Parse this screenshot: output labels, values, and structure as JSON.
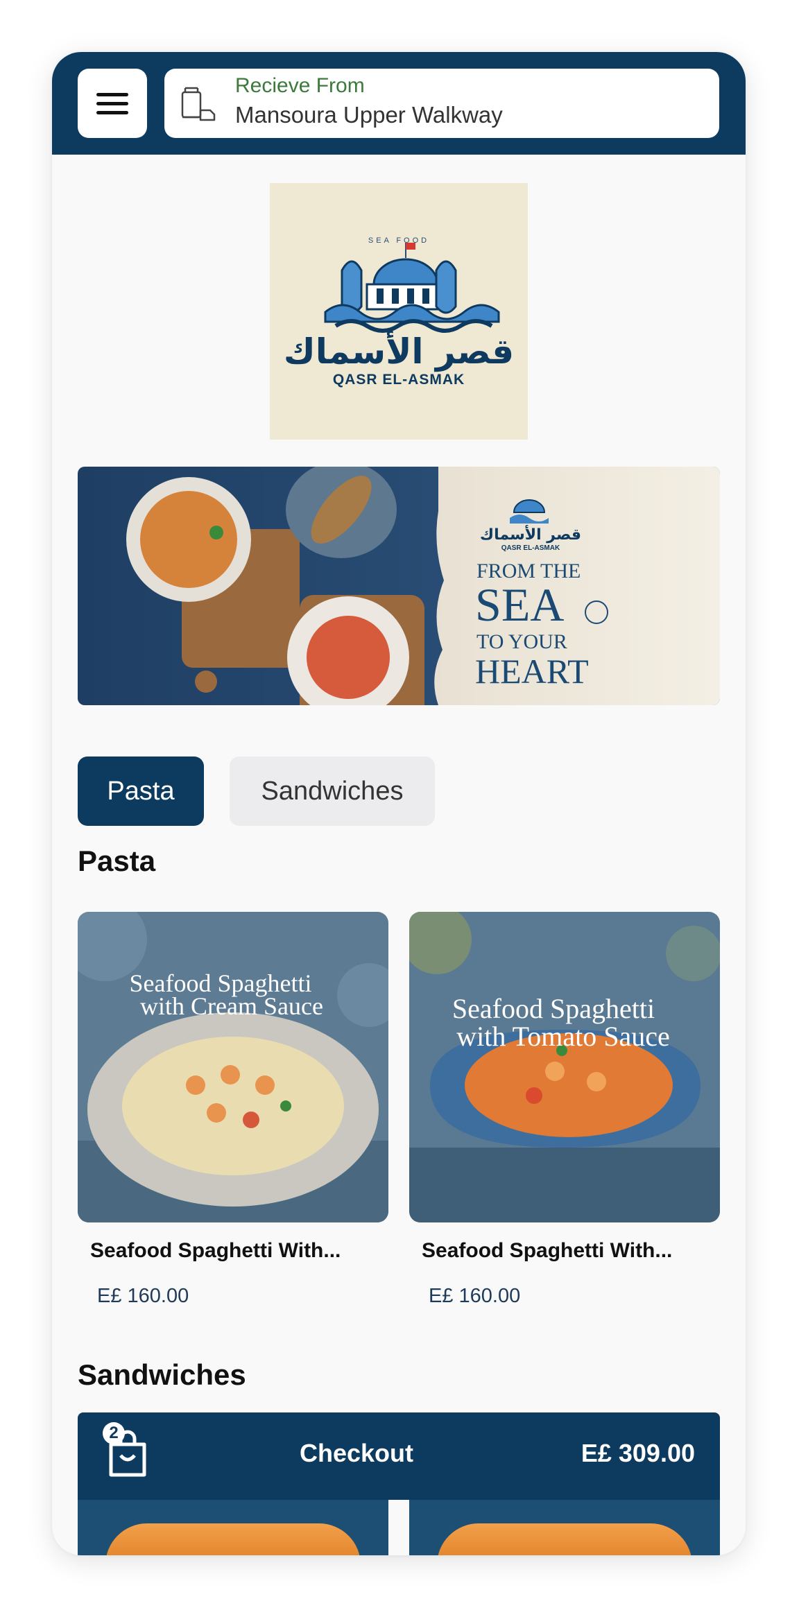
{
  "header": {
    "pickup_label": "Recieve From",
    "pickup_value": "Mansoura Upper Walkway"
  },
  "logo": {
    "arabic_name": "قصر الأسماك",
    "latin_name": "QASR EL-ASMAK",
    "tagline": "SEA FOOD"
  },
  "banner": {
    "logo_arabic": "قصر الأسماك",
    "logo_latin": "QASR EL-ASMAK",
    "line1": "FROM THE",
    "line2": "SEA",
    "line3": "TO YOUR",
    "line4": "HEART"
  },
  "tabs": [
    {
      "label": "Pasta",
      "active": true
    },
    {
      "label": "Sandwiches",
      "active": false
    }
  ],
  "sections": {
    "pasta_title": "Pasta",
    "sandwiches_title": "Sandwiches"
  },
  "products": [
    {
      "name": "Seafood Spaghetti With...",
      "price": "E£ 160.00",
      "image_line1": "Seafood Spaghetti",
      "image_line2": "with Cream Sauce",
      "plate_color": "#c9c7c0"
    },
    {
      "name": "Seafood Spaghetti With...",
      "price": "E£ 160.00",
      "image_line1": "Seafood Spaghetti",
      "image_line2": "with Tomato Sauce",
      "plate_color": "#3d6e9e"
    }
  ],
  "checkout": {
    "count": "2",
    "label": "Checkout",
    "total": "E£  309.00"
  },
  "colors": {
    "primary": "#0d3a5f",
    "background": "#f9f9fa",
    "logo_bg": "#efe8d3"
  }
}
